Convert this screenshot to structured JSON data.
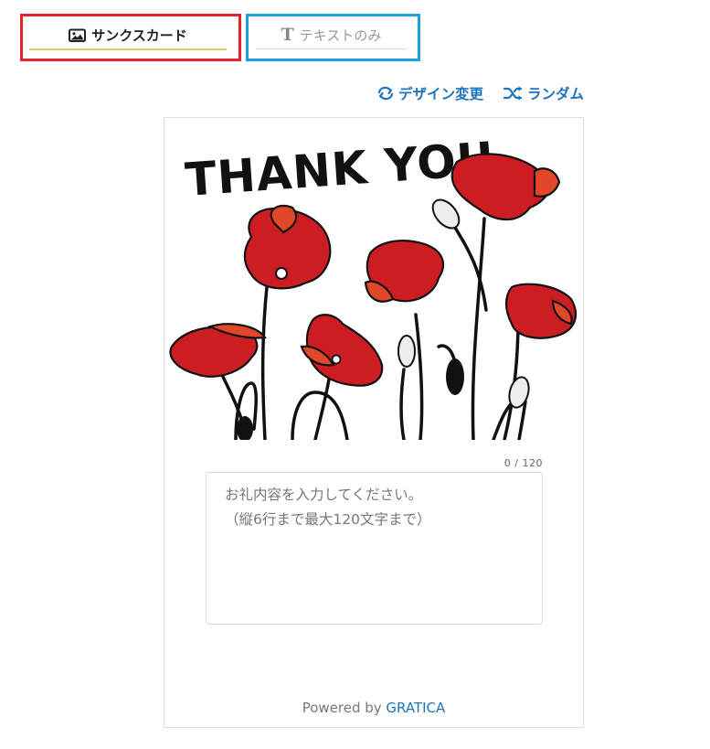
{
  "tabs": {
    "card_label": "サンクスカード",
    "text_label": "テキストのみ",
    "text_icon_glyph": "T"
  },
  "actions": {
    "change_design": "デザイン変更",
    "random": "ランダム"
  },
  "card": {
    "headline": "THANK YOU",
    "counter": "0 / 120",
    "message_placeholder": "お礼内容を入力してください。\n（縦6行まで最大120文字まで）",
    "powered_prefix": "Powered by ",
    "powered_brand": "GRATICA"
  },
  "colors": {
    "card_tab_border": "#e3232d",
    "text_tab_border": "#1aa3e0",
    "accent_link": "#1e73be",
    "poppy_red": "#cc1d22"
  },
  "icons": {
    "card_tab": "image-icon",
    "text_tab": "text-t-icon",
    "change_design": "refresh-icon",
    "random": "shuffle-icon"
  }
}
